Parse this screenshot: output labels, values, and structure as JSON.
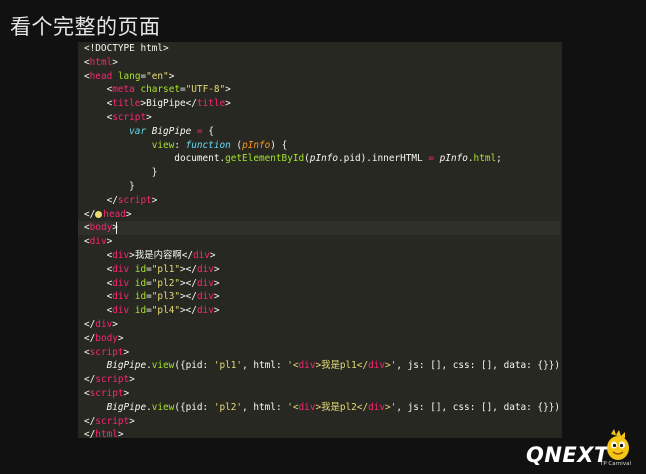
{
  "slide": {
    "title": "看个完整的页面"
  },
  "brand": {
    "name": "QNEXT",
    "caption": "TP Carnival"
  },
  "editor": {
    "cursor_line": 13,
    "lines": [
      [
        [
          "p",
          "<!DOCTYPE html>"
        ]
      ],
      [
        [
          "p",
          "<"
        ],
        [
          "tag",
          "html"
        ],
        [
          "p",
          ">"
        ]
      ],
      [
        [
          "p",
          "<"
        ],
        [
          "tag",
          "head"
        ],
        [
          "p",
          " "
        ],
        [
          "attr",
          "lang"
        ],
        [
          "p",
          "="
        ],
        [
          "str",
          "\"en\""
        ],
        [
          "p",
          ">"
        ]
      ],
      [
        [
          "p",
          "    <"
        ],
        [
          "tag",
          "meta"
        ],
        [
          "p",
          " "
        ],
        [
          "attr",
          "charset"
        ],
        [
          "p",
          "="
        ],
        [
          "str",
          "\"UTF-8\""
        ],
        [
          "p",
          ">"
        ]
      ],
      [
        [
          "p",
          "    <"
        ],
        [
          "tag",
          "title"
        ],
        [
          "p",
          ">BigPipe</"
        ],
        [
          "tag",
          "title"
        ],
        [
          "p",
          ">"
        ]
      ],
      [
        [
          "p",
          "    <"
        ],
        [
          "tag",
          "script"
        ],
        [
          "p",
          ">"
        ]
      ],
      [
        [
          "p",
          "        "
        ],
        [
          "kw",
          "var"
        ],
        [
          "p",
          " "
        ],
        [
          "ital",
          "BigPipe"
        ],
        [
          "p",
          " "
        ],
        [
          "op",
          "="
        ],
        [
          "p",
          " {"
        ]
      ],
      [
        [
          "p",
          "            "
        ],
        [
          "fn",
          "view"
        ],
        [
          "p",
          ": "
        ],
        [
          "kw",
          "function"
        ],
        [
          "p",
          " ("
        ],
        [
          "param",
          "pInfo"
        ],
        [
          "p",
          ") {"
        ]
      ],
      [
        [
          "p",
          "                document."
        ],
        [
          "fn",
          "getElementById"
        ],
        [
          "p",
          "("
        ],
        [
          "ital",
          "pInfo"
        ],
        [
          "p",
          ".pid).innerHTML "
        ],
        [
          "op",
          "="
        ],
        [
          "p",
          " "
        ],
        [
          "ital",
          "pInfo"
        ],
        [
          "p",
          "."
        ],
        [
          "fn",
          "html"
        ],
        [
          "p",
          ";"
        ]
      ],
      [
        [
          "p",
          "            }"
        ]
      ],
      [
        [
          "p",
          "        }"
        ]
      ],
      [
        [
          "p",
          "    </"
        ],
        [
          "tag",
          "script"
        ],
        [
          "p",
          ">"
        ]
      ],
      [
        [
          "p",
          "</"
        ],
        [
          "dot",
          ""
        ],
        [
          "tag",
          "head"
        ],
        [
          "p",
          ">"
        ]
      ],
      [
        [
          "p",
          "<"
        ],
        [
          "tag",
          "body"
        ],
        [
          "p",
          ">"
        ]
      ],
      [
        [
          "p",
          "<"
        ],
        [
          "tag",
          "div"
        ],
        [
          "p",
          ">"
        ]
      ],
      [
        [
          "p",
          "    <"
        ],
        [
          "tag",
          "div"
        ],
        [
          "p",
          ">我是内容啊</"
        ],
        [
          "tag",
          "div"
        ],
        [
          "p",
          ">"
        ]
      ],
      [
        [
          "p",
          "    <"
        ],
        [
          "tag",
          "div"
        ],
        [
          "p",
          " "
        ],
        [
          "attr",
          "id"
        ],
        [
          "p",
          "="
        ],
        [
          "str",
          "\"pl1\""
        ],
        [
          "p",
          "></"
        ],
        [
          "tag",
          "div"
        ],
        [
          "p",
          ">"
        ]
      ],
      [
        [
          "p",
          "    <"
        ],
        [
          "tag",
          "div"
        ],
        [
          "p",
          " "
        ],
        [
          "attr",
          "id"
        ],
        [
          "p",
          "="
        ],
        [
          "str",
          "\"pl2\""
        ],
        [
          "p",
          "></"
        ],
        [
          "tag",
          "div"
        ],
        [
          "p",
          ">"
        ]
      ],
      [
        [
          "p",
          "    <"
        ],
        [
          "tag",
          "div"
        ],
        [
          "p",
          " "
        ],
        [
          "attr",
          "id"
        ],
        [
          "p",
          "="
        ],
        [
          "str",
          "\"pl3\""
        ],
        [
          "p",
          "></"
        ],
        [
          "tag",
          "div"
        ],
        [
          "p",
          ">"
        ]
      ],
      [
        [
          "p",
          "    <"
        ],
        [
          "tag",
          "div"
        ],
        [
          "p",
          " "
        ],
        [
          "attr",
          "id"
        ],
        [
          "p",
          "="
        ],
        [
          "str",
          "\"pl4\""
        ],
        [
          "p",
          "></"
        ],
        [
          "tag",
          "div"
        ],
        [
          "p",
          ">"
        ]
      ],
      [
        [
          "p",
          "</"
        ],
        [
          "tag",
          "div"
        ],
        [
          "p",
          ">"
        ]
      ],
      [
        [
          "p",
          "</"
        ],
        [
          "tag",
          "body"
        ],
        [
          "p",
          ">"
        ]
      ],
      [
        [
          "p",
          "<"
        ],
        [
          "tag",
          "script"
        ],
        [
          "p",
          ">"
        ]
      ],
      [
        [
          "p",
          "    "
        ],
        [
          "ital",
          "BigPipe"
        ],
        [
          "p",
          "."
        ],
        [
          "fn",
          "view"
        ],
        [
          "p",
          "({pid: "
        ],
        [
          "str",
          "'pl1'"
        ],
        [
          "p",
          ", html: "
        ],
        [
          "str",
          "'<"
        ],
        [
          "tag",
          "div"
        ],
        [
          "str",
          ">我是pl1</"
        ],
        [
          "tag",
          "div"
        ],
        [
          "str",
          ">'"
        ],
        [
          "p",
          ", js: [], css: [], data: {}})"
        ]
      ],
      [
        [
          "p",
          "</"
        ],
        [
          "tag",
          "script"
        ],
        [
          "p",
          ">"
        ]
      ],
      [
        [
          "p",
          "<"
        ],
        [
          "tag",
          "script"
        ],
        [
          "p",
          ">"
        ]
      ],
      [
        [
          "p",
          "    "
        ],
        [
          "ital",
          "BigPipe"
        ],
        [
          "p",
          "."
        ],
        [
          "fn",
          "view"
        ],
        [
          "p",
          "({pid: "
        ],
        [
          "str",
          "'pl2'"
        ],
        [
          "p",
          ", html: "
        ],
        [
          "str",
          "'<"
        ],
        [
          "tag",
          "div"
        ],
        [
          "str",
          ">我是pl2</"
        ],
        [
          "tag",
          "div"
        ],
        [
          "str",
          ">'"
        ],
        [
          "p",
          ", js: [], css: [], data: {}})"
        ]
      ],
      [
        [
          "p",
          "</"
        ],
        [
          "tag",
          "script"
        ],
        [
          "p",
          ">"
        ]
      ],
      [
        [
          "p",
          "</"
        ],
        [
          "tag",
          "html"
        ],
        [
          "p",
          ">"
        ]
      ]
    ]
  }
}
